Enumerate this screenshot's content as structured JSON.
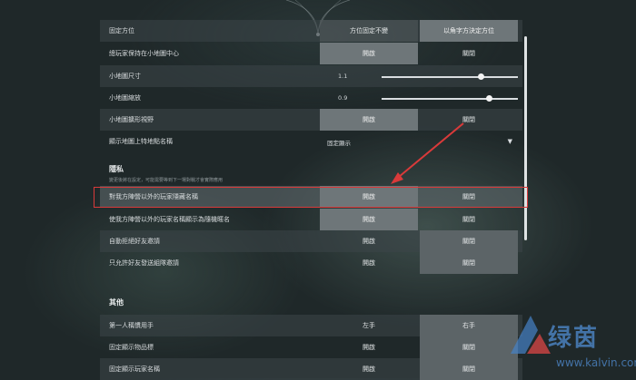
{
  "settings": {
    "rows": [
      {
        "label": "固定方位",
        "a": "方位固定不變",
        "b": "以角字方決定方位"
      },
      {
        "label": "總玩家保持在小地圖中心",
        "a": "開啟",
        "b": "關閉"
      },
      {
        "label": "小地圖尺寸",
        "value": "1.1",
        "fill": 0.73
      },
      {
        "label": "小地圖縮放",
        "value": "0.9",
        "fill": 0.79
      },
      {
        "label": "小地圖擴形視野",
        "a": "開啟",
        "b": "關閉"
      },
      {
        "label": "顯示地圖上特地點名稱",
        "dropdown": "固定顯示"
      }
    ],
    "privacy": {
      "title": "隱私",
      "hint": "變更後將在設定，可能需要等到下一場對戰才會實際應用",
      "rows": [
        {
          "label": "對我方陣營以外的玩家隱藏名稱",
          "a": "開啟",
          "b": "關閉"
        },
        {
          "label": "使我方陣營以外的玩家名稱顯示為隨機暱名",
          "a": "開啟",
          "b": "關閉"
        },
        {
          "label": "自動拒絕好友邀請",
          "a": "開啟",
          "b": "關閉"
        },
        {
          "label": "只允許好友發送組隊邀請",
          "a": "開啟",
          "b": "關閉"
        }
      ]
    },
    "other": {
      "title": "其他",
      "rows": [
        {
          "label": "第一人稱慣用手",
          "a": "左手",
          "b": "右手"
        },
        {
          "label": "固定顯示物品標",
          "a": "開啟",
          "b": "關閉"
        },
        {
          "label": "固定顯示玩家名稱",
          "a": "開啟",
          "b": "關閉"
        }
      ]
    }
  },
  "watermark": {
    "text": "绿茵",
    "url": "www.kalvin.com"
  },
  "colors": {
    "highlight": "#d93a3a",
    "accent_arrow": "#d93a3a"
  }
}
